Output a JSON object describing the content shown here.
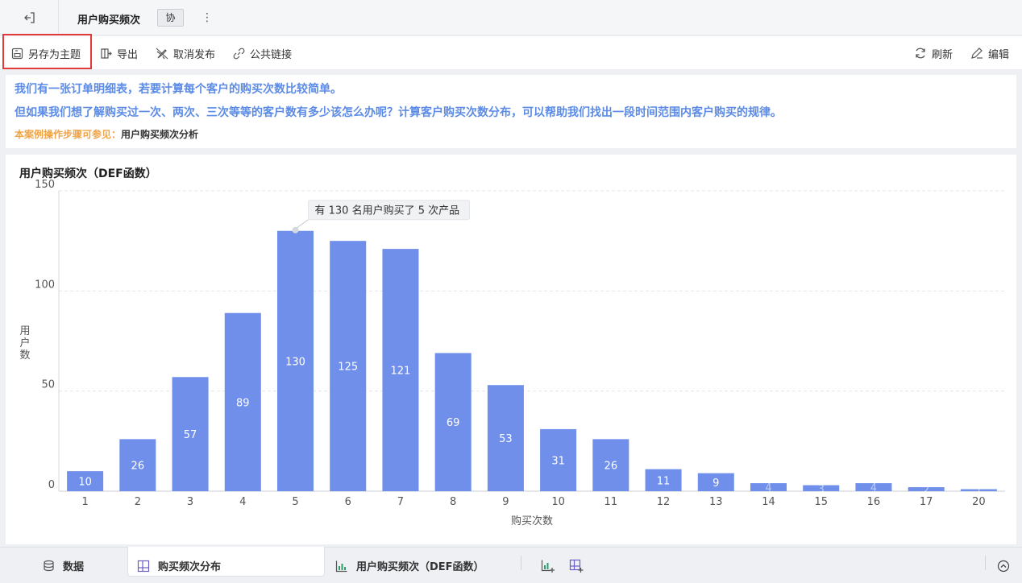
{
  "titlebar": {
    "doc_title": "用户购买频次",
    "collab_badge": "协"
  },
  "toolbar": {
    "save_as_theme": "另存为主题",
    "export": "导出",
    "unpublish": "取消发布",
    "public_link": "公共链接",
    "refresh": "刷新",
    "edit": "编辑"
  },
  "description": {
    "line1": "我们有一张订单明细表，若要计算每个客户的购买次数比较简单。",
    "line2": "但如果我们想了解购买过一次、两次、三次等等的客户数有多少该怎么办呢？计算客户购买次数分布，可以帮助我们找出一段时间范围内客户购买的规律。",
    "ref_prefix": "本案例操作步骤可参见：",
    "ref_link": "用户购买频次分析"
  },
  "chart_data": {
    "type": "bar",
    "title": "用户购买频次（DEF函数）",
    "xlabel": "购买次数",
    "ylabel": "用户数",
    "categories": [
      "1",
      "2",
      "3",
      "4",
      "5",
      "6",
      "7",
      "8",
      "9",
      "10",
      "11",
      "12",
      "13",
      "14",
      "15",
      "16",
      "17",
      "20"
    ],
    "values": [
      10,
      26,
      57,
      89,
      130,
      125,
      121,
      69,
      53,
      31,
      26,
      11,
      9,
      4,
      3,
      4,
      2,
      1
    ],
    "ylim": [
      0,
      150
    ],
    "yticks": [
      0,
      50,
      100,
      150
    ],
    "grid": true,
    "color": "#6f8fea",
    "tooltip": "有 130 名用户购买了 5 次产品",
    "tooltip_index": 4
  },
  "bottombar": {
    "data_tab": "数据",
    "tab1": "购买频次分布",
    "tab2": "用户购买频次（DEF函数）"
  },
  "colors": {
    "accent": "#5b8be6",
    "bar": "#6f8fea",
    "highlight": "#e23a3a",
    "ref_prefix": "#f0a448"
  }
}
